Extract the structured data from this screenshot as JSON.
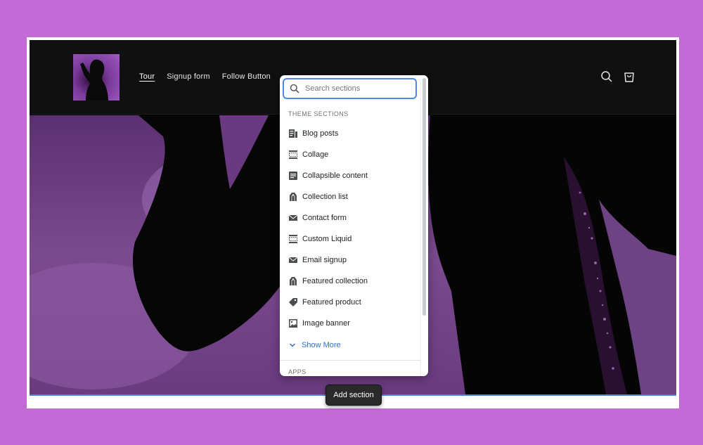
{
  "header": {
    "nav": [
      {
        "label": "Tour",
        "active": true
      },
      {
        "label": "Signup form",
        "active": false
      },
      {
        "label": "Follow Button",
        "active": false
      }
    ],
    "icons": [
      "search-icon",
      "cart-icon"
    ]
  },
  "popover": {
    "search_placeholder": "Search sections",
    "theme_sections_label": "THEME SECTIONS",
    "items": [
      {
        "label": "Blog posts",
        "icon": "blog-icon"
      },
      {
        "label": "Collage",
        "icon": "layout-icon"
      },
      {
        "label": "Collapsible content",
        "icon": "text-block-icon"
      },
      {
        "label": "Collection list",
        "icon": "collection-icon"
      },
      {
        "label": "Contact form",
        "icon": "email-icon"
      },
      {
        "label": "Custom Liquid",
        "icon": "layout-icon"
      },
      {
        "label": "Email signup",
        "icon": "email-icon"
      },
      {
        "label": "Featured collection",
        "icon": "collection-icon"
      },
      {
        "label": "Featured product",
        "icon": "tag-icon"
      },
      {
        "label": "Image banner",
        "icon": "image-icon"
      }
    ],
    "show_more_label": "Show More",
    "apps_label": "APPS"
  },
  "add_section_label": "Add section",
  "colors": {
    "page_background": "#c36ad6",
    "header_background": "#101010",
    "accent_blue": "#2c6ecb",
    "focus_ring": "#4c89e8"
  }
}
